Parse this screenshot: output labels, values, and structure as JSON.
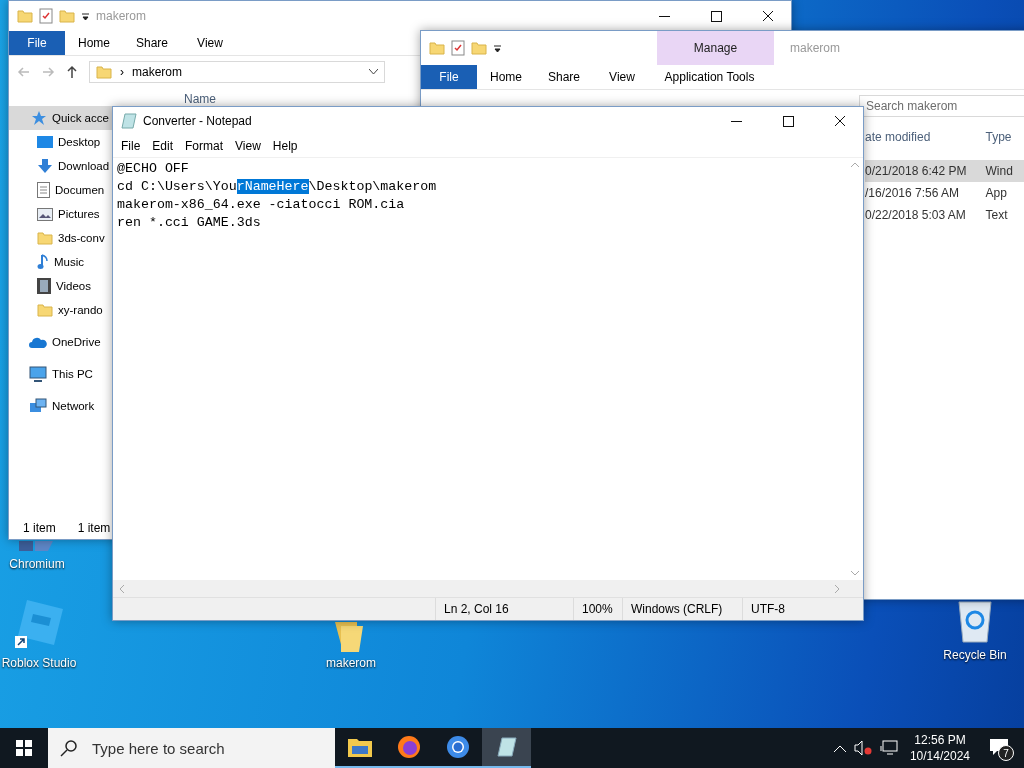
{
  "desktop_icons": [
    {
      "label": "Chromium",
      "kind": "chromium"
    },
    {
      "label": "Roblox Studio",
      "kind": "roblox"
    },
    {
      "label": "makerom",
      "kind": "folder"
    },
    {
      "label": "Recycle Bin",
      "kind": "bin"
    }
  ],
  "explorer_left": {
    "title": "makerom",
    "file_menu": "File",
    "tabs": [
      "Home",
      "Share",
      "View"
    ],
    "address_separator": "›",
    "address": "makerom",
    "column": "Name",
    "nav": [
      {
        "label": "Quick acce",
        "kind": "star",
        "selected": true
      },
      {
        "label": "Desktop",
        "kind": "desktop",
        "selected": false
      },
      {
        "label": "Download",
        "kind": "download",
        "selected": false
      },
      {
        "label": "Documen",
        "kind": "document",
        "selected": false
      },
      {
        "label": "Pictures",
        "kind": "pictures",
        "selected": false
      },
      {
        "label": "3ds-conv",
        "kind": "folder",
        "selected": false
      },
      {
        "label": "Music",
        "kind": "music",
        "selected": false
      },
      {
        "label": "Videos",
        "kind": "videos",
        "selected": false
      },
      {
        "label": "xy-rando",
        "kind": "folder",
        "selected": false
      },
      {
        "label": "OneDrive",
        "kind": "cloud",
        "selected": false
      },
      {
        "label": "This PC",
        "kind": "pc",
        "selected": false
      },
      {
        "label": "Network",
        "kind": "network",
        "selected": false
      }
    ],
    "status": [
      "1 item",
      "1 item"
    ]
  },
  "explorer_right": {
    "title": "makerom",
    "context_tab": "Manage",
    "file_menu": "File",
    "tabs": [
      "Home",
      "Share",
      "View",
      "Application Tools"
    ],
    "search_placeholder": "Search makerom",
    "columns": [
      "ate modified",
      "Type"
    ],
    "rows": [
      {
        "cells": [
          "0/21/2018 6:42 PM",
          "Wind"
        ],
        "selected": true
      },
      {
        "cells": [
          "/16/2016 7:56 AM",
          "App"
        ],
        "selected": false
      },
      {
        "cells": [
          "0/22/2018 5:03 AM",
          "Text"
        ],
        "selected": false
      }
    ]
  },
  "notepad": {
    "title": "Converter - Notepad",
    "menu": [
      "File",
      "Edit",
      "Format",
      "View",
      "Help"
    ],
    "lines": [
      {
        "segments": [
          {
            "text": "@ECHO OFF",
            "selected": false
          }
        ]
      },
      {
        "segments": [
          {
            "text": "cd C:\\Users\\You",
            "selected": false
          },
          {
            "text": "rNameHere",
            "selected": true
          },
          {
            "text": "\\Desktop\\makerom",
            "selected": false
          }
        ]
      },
      {
        "segments": [
          {
            "text": "makerom-x86_64.exe -ciatocci ROM.cia",
            "selected": false
          }
        ]
      },
      {
        "segments": [
          {
            "text": "ren *.cci GAME.3ds",
            "selected": false
          }
        ]
      }
    ],
    "status": [
      "Ln 2, Col 16",
      "100%",
      "Windows (CRLF)",
      "UTF-8"
    ]
  },
  "taskbar": {
    "search_placeholder": "Type here to search",
    "apps": [
      {
        "kind": "explorer",
        "selected": false
      },
      {
        "kind": "firefox",
        "selected": false
      },
      {
        "kind": "chromium",
        "selected": false
      },
      {
        "kind": "notepad",
        "selected": true
      }
    ],
    "time": "12:56 PM",
    "date": "10/14/2024",
    "notification_count": "7"
  }
}
